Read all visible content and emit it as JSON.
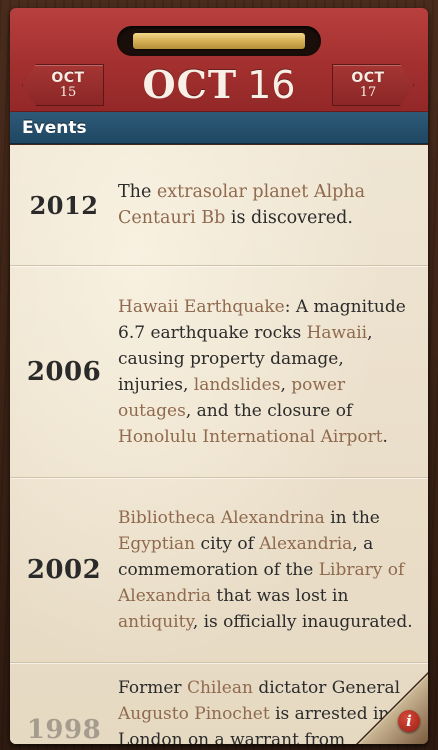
{
  "header": {
    "title_month": "OCT",
    "title_day": "16",
    "prev": {
      "month": "OCT",
      "day": "15"
    },
    "next": {
      "month": "OCT",
      "day": "17"
    }
  },
  "section": {
    "label": "Events"
  },
  "events": [
    {
      "year": "2012",
      "segments": [
        {
          "text": "The ",
          "link": false
        },
        {
          "text": "extrasolar planet Alpha Centauri Bb",
          "link": true
        },
        {
          "text": " is discovered.",
          "link": false
        }
      ]
    },
    {
      "year": "2006",
      "segments": [
        {
          "text": "Hawaii Earthquake",
          "link": true
        },
        {
          "text": ": A magnitude 6.7 earthquake rocks ",
          "link": false
        },
        {
          "text": "Hawaii",
          "link": true
        },
        {
          "text": ", causing property damage, injuries, ",
          "link": false
        },
        {
          "text": "landslides",
          "link": true
        },
        {
          "text": ", ",
          "link": false
        },
        {
          "text": "power outages",
          "link": true
        },
        {
          "text": ", and the closure of ",
          "link": false
        },
        {
          "text": "Honolulu International Airport",
          "link": true
        },
        {
          "text": ".",
          "link": false
        }
      ]
    },
    {
      "year": "2002",
      "segments": [
        {
          "text": "Bibliotheca Alexandrina",
          "link": true
        },
        {
          "text": " in the ",
          "link": false
        },
        {
          "text": "Egyptian",
          "link": true
        },
        {
          "text": " city of ",
          "link": false
        },
        {
          "text": "Alexandria",
          "link": true
        },
        {
          "text": ", a commemoration of the ",
          "link": false
        },
        {
          "text": "Library of Alexandria",
          "link": true
        },
        {
          "text": " that was lost in ",
          "link": false
        },
        {
          "text": "antiquity",
          "link": true
        },
        {
          "text": ", is officially inaugurated.",
          "link": false
        }
      ]
    },
    {
      "year": "1998",
      "segments": [
        {
          "text": "Former ",
          "link": false
        },
        {
          "text": "Chilean",
          "link": true
        },
        {
          "text": " dictator General ",
          "link": false
        },
        {
          "text": "Augusto Pinochet",
          "link": true
        },
        {
          "text": " is arrested in London on a warrant from",
          "link": false
        }
      ]
    }
  ],
  "info": {
    "glyph": "i"
  },
  "colors": {
    "header_red": "#a3302f",
    "section_blue": "#1f4763",
    "link_brown": "#8f6a4e",
    "paper": "#ede2cf",
    "gold_ring": "#d9b45a"
  },
  "icons": {
    "prev": "left-arrow-tab",
    "next": "right-arrow-tab",
    "info": "info-icon"
  }
}
